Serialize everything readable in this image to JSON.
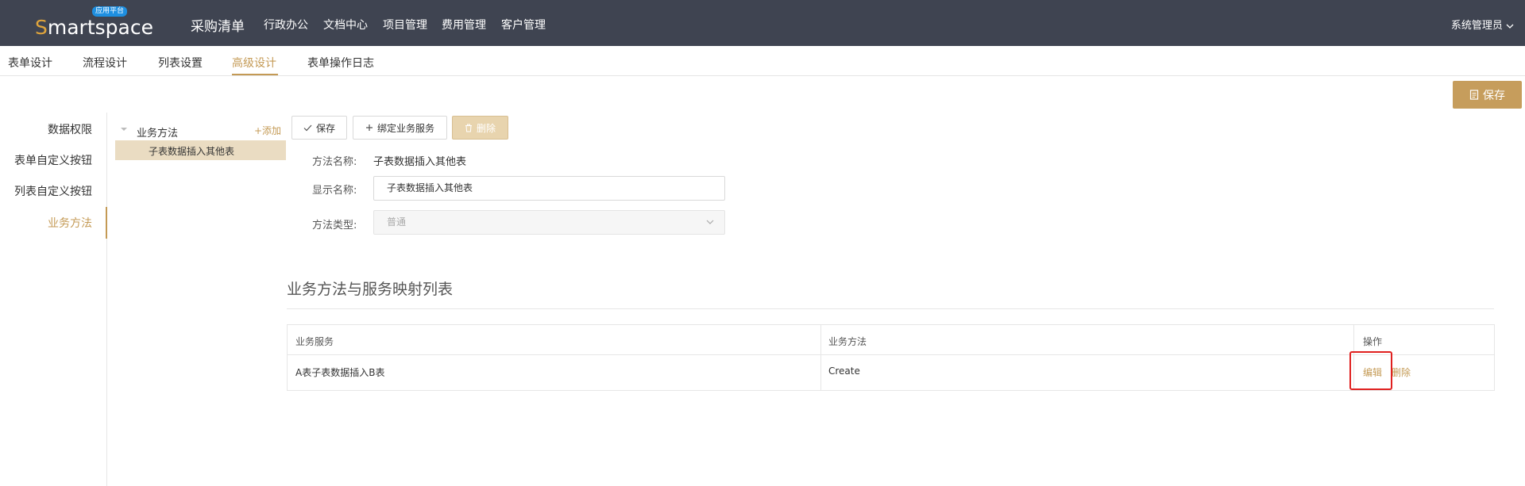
{
  "header": {
    "logo_text_first": "S",
    "logo_text_rest": "martspace",
    "logo_badge": "应用平台",
    "app_title": "采购清单",
    "nav": [
      "行政办公",
      "文档中心",
      "项目管理",
      "费用管理",
      "客户管理"
    ],
    "user": "系统管理员"
  },
  "tabs": [
    "表单设计",
    "流程设计",
    "列表设置",
    "高级设计",
    "表单操作日志"
  ],
  "active_tab": "高级设计",
  "top_save_label": "保存",
  "left_menu": [
    "数据权限",
    "表单自定义按钮",
    "列表自定义按钮",
    "业务方法"
  ],
  "active_menu": "业务方法",
  "tree": {
    "root": "业务方法",
    "add": "+添加",
    "child": "子表数据插入其他表"
  },
  "actions": {
    "save": "保存",
    "bind": "绑定业务服务",
    "delete": "删除"
  },
  "form": {
    "method_name_label": "方法名称:",
    "method_name_value": "子表数据插入其他表",
    "display_name_label": "显示名称:",
    "display_name_value": "子表数据插入其他表",
    "method_type_label": "方法类型:",
    "method_type_value": "普通"
  },
  "section_title": "业务方法与服务映射列表",
  "table": {
    "headers": [
      "业务服务",
      "业务方法",
      "操作"
    ],
    "rows": [
      {
        "service": "A表子表数据插入B表",
        "method": "Create",
        "edit": "编辑",
        "delete": "删除"
      }
    ]
  },
  "colors": {
    "topbar": "#3f4451",
    "accent": "#c49a55",
    "highlight": "#e0201f"
  }
}
